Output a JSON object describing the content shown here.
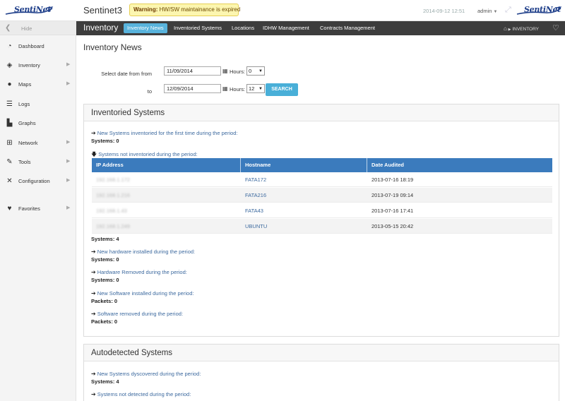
{
  "header": {
    "app_title": "Sentinet3",
    "logo_text": "SentiNet",
    "warning_label": "Warning:",
    "warning_text": "HW/SW maintainance is expired",
    "datetime": "2014-09-12 12:51",
    "user": "admin"
  },
  "sidebar": {
    "hide_label": "Hide",
    "items": [
      {
        "label": "Dashboard",
        "icon": "dashboard-icon",
        "has_arrow": false
      },
      {
        "label": "Inventory",
        "icon": "tag-icon",
        "has_arrow": true
      },
      {
        "label": "Maps",
        "icon": "globe-icon",
        "has_arrow": true
      },
      {
        "label": "Logs",
        "icon": "list-icon",
        "has_arrow": false
      },
      {
        "label": "Graphs",
        "icon": "bar-chart-icon",
        "has_arrow": false
      },
      {
        "label": "Network",
        "icon": "sitemap-icon",
        "has_arrow": true
      },
      {
        "label": "Tools",
        "icon": "wrench-icon",
        "has_arrow": true
      },
      {
        "label": "Configuration",
        "icon": "tools-icon",
        "has_arrow": true
      },
      {
        "label": "Favorites",
        "icon": "heart-icon",
        "has_arrow": true
      }
    ]
  },
  "navbar": {
    "section_title": "Inventory",
    "tabs": [
      "Inventory News",
      "Inventoried Systems",
      "Locations",
      "IDHW Management",
      "Contracts Management"
    ],
    "active_tab": "Inventory News",
    "breadcrumb": "INVENTORY"
  },
  "main": {
    "page_title": "Inventory News",
    "form": {
      "from_label": "Select date from from",
      "to_label": "to",
      "from_date": "11/09/2014",
      "to_date": "12/09/2014",
      "hours_label": "Hours:",
      "from_hours": "0",
      "to_hours": "12",
      "search_label": "SEARCH"
    },
    "inventoried": {
      "title": "Inventoried Systems",
      "new_systems_link": "New Systems inventoried for the first time during the period:",
      "new_systems_count": "Systems: 0",
      "not_inventoried_link": "Systems not inventoried during the period:",
      "columns": [
        "IP Address",
        "Hostname",
        "Date Audited"
      ],
      "rows": [
        {
          "ip": "192.168.1.172",
          "hostname": "FATA172",
          "date": "2013-07-16 18:19"
        },
        {
          "ip": "192.168.1.216",
          "hostname": "FATA216",
          "date": "2013-07-19 09:14"
        },
        {
          "ip": "192.168.1.43",
          "hostname": "FATA43",
          "date": "2013-07-16 17:41"
        },
        {
          "ip": "192.168.1.249",
          "hostname": "UBUNTU",
          "date": "2013-05-15 20:42"
        }
      ],
      "not_inventoried_count": "Systems: 4",
      "hw_installed_link": "New hardware installed during the period:",
      "hw_installed_count": "Systems: 0",
      "hw_removed_link": "Hardware Removed during the period:",
      "hw_removed_count": "Systems: 0",
      "sw_installed_link": "New Software installed during the period:",
      "sw_installed_count": "Packets: 0",
      "sw_removed_link": "Software removed during the period:",
      "sw_removed_count": "Packets: 0"
    },
    "autodetected": {
      "title": "Autodetected Systems",
      "discovered_link": "New Systems dyscovered during the period:",
      "discovered_count": "Systems: 4",
      "not_detected_link": "Systems not detected during the period:"
    }
  }
}
